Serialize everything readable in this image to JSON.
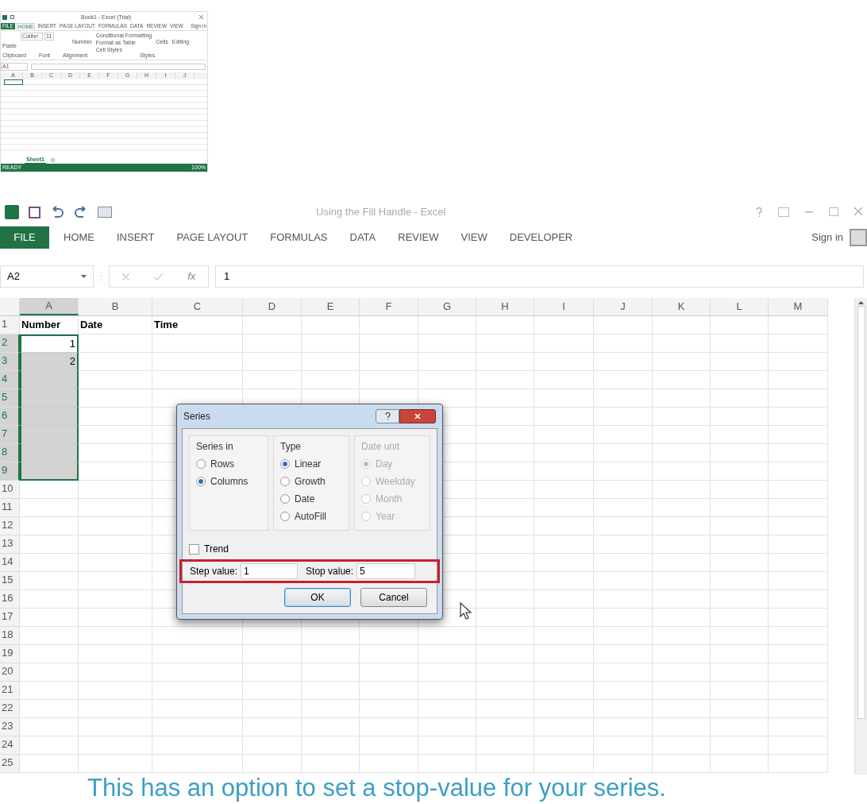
{
  "thumbnail": {
    "title": "Book1 - Excel (Trial)",
    "tabs": [
      {
        "label": "FILE",
        "kind": "file",
        "selected": false
      },
      {
        "label": "HOME",
        "kind": "tab",
        "selected": true
      },
      {
        "label": "INSERT",
        "kind": "tab",
        "selected": false
      },
      {
        "label": "PAGE LAYOUT",
        "kind": "tab",
        "selected": false
      },
      {
        "label": "FORMULAS",
        "kind": "tab",
        "selected": false
      },
      {
        "label": "DATA",
        "kind": "tab",
        "selected": false
      },
      {
        "label": "REVIEW",
        "kind": "tab",
        "selected": false
      },
      {
        "label": "VIEW",
        "kind": "tab",
        "selected": false
      }
    ],
    "sign_in": "Sign in",
    "ribbon": {
      "paste": "Paste",
      "font": "Calibri",
      "size": "11",
      "number": "Number",
      "styles": [
        "Conditional Formatting",
        "Format as Table",
        "Cell Styles"
      ],
      "cells": "Cells",
      "editing": "Editing",
      "groups": [
        "Clipboard",
        "Font",
        "Alignment",
        "Styles"
      ]
    },
    "name_box": "A1",
    "columns": [
      "A",
      "B",
      "C",
      "D",
      "E",
      "F",
      "G",
      "H",
      "I",
      "J"
    ],
    "sheet_tab": "Sheet1",
    "status": "READY",
    "zoom": "100%"
  },
  "window": {
    "title": "Using the Fill Handle - Excel",
    "tabs": [
      {
        "label": "FILE",
        "kind": "file",
        "selected": false
      },
      {
        "label": "HOME",
        "kind": "tab",
        "selected": false
      },
      {
        "label": "INSERT",
        "kind": "tab",
        "selected": false
      },
      {
        "label": "PAGE LAYOUT",
        "kind": "tab",
        "selected": false
      },
      {
        "label": "FORMULAS",
        "kind": "tab",
        "selected": false
      },
      {
        "label": "DATA",
        "kind": "tab",
        "selected": false
      },
      {
        "label": "REVIEW",
        "kind": "tab",
        "selected": false
      },
      {
        "label": "VIEW",
        "kind": "tab",
        "selected": false
      },
      {
        "label": "DEVELOPER",
        "kind": "tab",
        "selected": false
      }
    ],
    "sign_in": "Sign in"
  },
  "formula_bar": {
    "name_box": "A2",
    "function_label": "fx",
    "value": "1"
  },
  "sheet": {
    "columns": [
      {
        "label": "A",
        "selected": true
      },
      {
        "label": "B",
        "selected": false
      },
      {
        "label": "C",
        "selected": false
      },
      {
        "label": "D",
        "selected": false
      },
      {
        "label": "E",
        "selected": false
      },
      {
        "label": "F",
        "selected": false
      },
      {
        "label": "G",
        "selected": false
      },
      {
        "label": "H",
        "selected": false
      },
      {
        "label": "I",
        "selected": false
      },
      {
        "label": "J",
        "selected": false
      },
      {
        "label": "K",
        "selected": false
      },
      {
        "label": "L",
        "selected": false
      },
      {
        "label": "M",
        "selected": false
      }
    ],
    "rows": [
      {
        "header": "1",
        "selected": false,
        "active": false,
        "cells": [
          "Number",
          "Date",
          "Time"
        ]
      },
      {
        "header": "2",
        "selected": true,
        "active": true,
        "cells": [
          "1"
        ]
      },
      {
        "header": "3",
        "selected": true,
        "active": false,
        "cells": [
          "2"
        ]
      },
      {
        "header": "4",
        "selected": true,
        "active": false,
        "cells": []
      },
      {
        "header": "5",
        "selected": true,
        "active": false,
        "cells": []
      },
      {
        "header": "6",
        "selected": true,
        "active": false,
        "cells": []
      },
      {
        "header": "7",
        "selected": true,
        "active": false,
        "cells": []
      },
      {
        "header": "8",
        "selected": true,
        "active": false,
        "cells": []
      },
      {
        "header": "9",
        "selected": true,
        "active": false,
        "cells": []
      },
      {
        "header": "10",
        "selected": false,
        "active": false,
        "cells": []
      },
      {
        "header": "11",
        "selected": false,
        "active": false,
        "cells": []
      },
      {
        "header": "12",
        "selected": false,
        "active": false,
        "cells": []
      },
      {
        "header": "13",
        "selected": false,
        "active": false,
        "cells": []
      },
      {
        "header": "14",
        "selected": false,
        "active": false,
        "cells": []
      },
      {
        "header": "15",
        "selected": false,
        "active": false,
        "cells": []
      },
      {
        "header": "16",
        "selected": false,
        "active": false,
        "cells": []
      },
      {
        "header": "17",
        "selected": false,
        "active": false,
        "cells": []
      },
      {
        "header": "18",
        "selected": false,
        "active": false,
        "cells": []
      },
      {
        "header": "19",
        "selected": false,
        "active": false,
        "cells": []
      },
      {
        "header": "20",
        "selected": false,
        "active": false,
        "cells": []
      },
      {
        "header": "21",
        "selected": false,
        "active": false,
        "cells": []
      },
      {
        "header": "22",
        "selected": false,
        "active": false,
        "cells": []
      },
      {
        "header": "23",
        "selected": false,
        "active": false,
        "cells": []
      },
      {
        "header": "24",
        "selected": false,
        "active": false,
        "cells": []
      },
      {
        "header": "25",
        "selected": false,
        "active": false,
        "cells": []
      }
    ]
  },
  "dialog": {
    "title": "Series",
    "series_in": {
      "label": "Series in",
      "disabled": false,
      "options": [
        {
          "label": "Rows",
          "selected": false
        },
        {
          "label": "Columns",
          "selected": true
        }
      ]
    },
    "type": {
      "label": "Type",
      "disabled": false,
      "options": [
        {
          "label": "Linear",
          "selected": true
        },
        {
          "label": "Growth",
          "selected": false
        },
        {
          "label": "Date",
          "selected": false
        },
        {
          "label": "AutoFill",
          "selected": false
        }
      ]
    },
    "date_unit": {
      "label": "Date unit",
      "disabled": true,
      "options": [
        {
          "label": "Day",
          "selected": true
        },
        {
          "label": "Weekday",
          "selected": false
        },
        {
          "label": "Month",
          "selected": false
        },
        {
          "label": "Year",
          "selected": false
        }
      ]
    },
    "trend": {
      "label": "Trend",
      "checked": false
    },
    "step": {
      "label": "Step value:",
      "value": "1"
    },
    "stop": {
      "label": "Stop value:",
      "value": "5"
    },
    "highlighted": true,
    "buttons": [
      {
        "label": "OK",
        "default": true
      },
      {
        "label": "Cancel",
        "default": false
      }
    ]
  },
  "caption": "This has an option to set a stop-value for your series."
}
